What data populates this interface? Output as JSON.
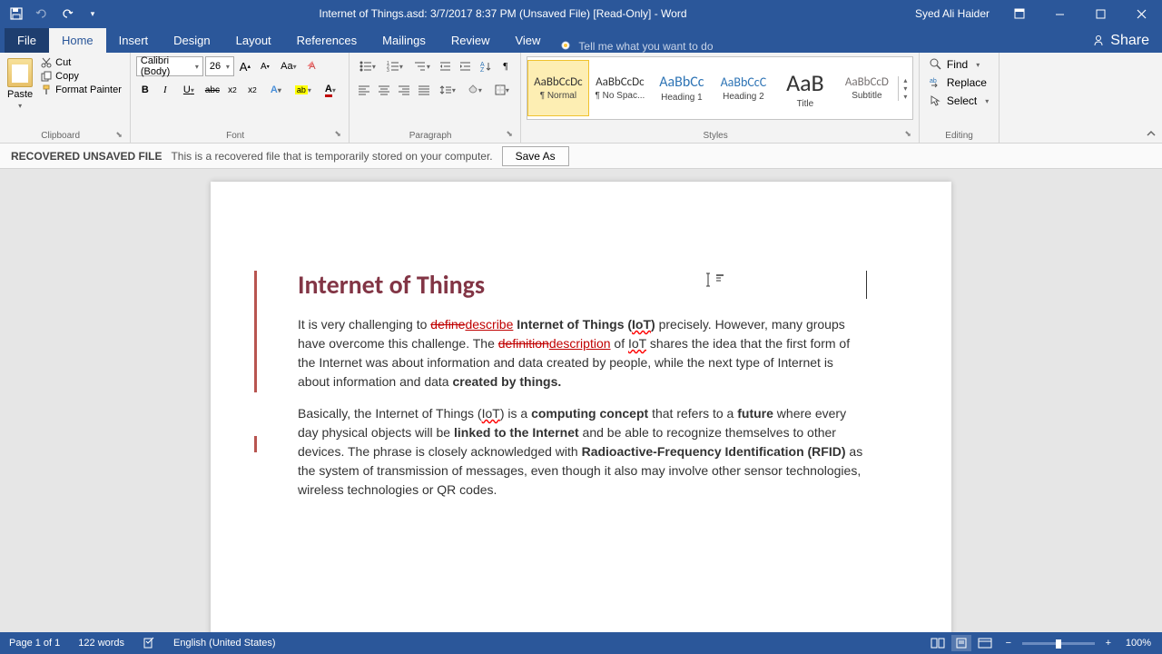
{
  "titlebar": {
    "title": "Internet of Things.asd: 3/7/2017 8:37 PM (Unsaved File) [Read-Only] - Word",
    "user": "Syed Ali Haider"
  },
  "tabs": {
    "file": "File",
    "home": "Home",
    "insert": "Insert",
    "design": "Design",
    "layout": "Layout",
    "references": "References",
    "mailings": "Mailings",
    "review": "Review",
    "view": "View",
    "tellme": "Tell me what you want to do",
    "share": "Share"
  },
  "clipboard": {
    "paste": "Paste",
    "cut": "Cut",
    "copy": "Copy",
    "formatpainter": "Format Painter",
    "label": "Clipboard"
  },
  "font": {
    "name": "Calibri (Body)",
    "size": "26",
    "label": "Font"
  },
  "paragraph": {
    "label": "Paragraph"
  },
  "styles": {
    "label": "Styles",
    "items": [
      {
        "preview": "AaBbCcDc",
        "name": "¶ Normal",
        "size": "13px",
        "color": "#333"
      },
      {
        "preview": "AaBbCcDc",
        "name": "¶ No Spac...",
        "size": "13px",
        "color": "#333"
      },
      {
        "preview": "AaBbCc",
        "name": "Heading 1",
        "size": "16px",
        "color": "#2e74b5"
      },
      {
        "preview": "AaBbCcC",
        "name": "Heading 2",
        "size": "14px",
        "color": "#2e74b5"
      },
      {
        "preview": "AaB",
        "name": "Title",
        "size": "26px",
        "color": "#333"
      },
      {
        "preview": "AaBbCcD",
        "name": "Subtitle",
        "size": "13px",
        "color": "#767171"
      }
    ]
  },
  "editing": {
    "find": "Find",
    "replace": "Replace",
    "select": "Select",
    "label": "Editing"
  },
  "recover": {
    "label": "RECOVERED UNSAVED FILE",
    "text": "This is a recovered file that is temporarily stored on your computer.",
    "button": "Save As"
  },
  "document": {
    "title": "Internet of Things",
    "p1_a": "It is very challenging to ",
    "p1_strike1": "define",
    "p1_ins1": "describe",
    "p1_b": " ",
    "p1_bold1": "Internet of Things (",
    "p1_iot1": "IoT",
    "p1_bold1b": ")",
    "p1_c": " precisely. However, many groups have overcome this challenge. The ",
    "p1_strike2": "definition",
    "p1_ins2": "description",
    "p1_d": " of ",
    "p1_iot2": "IoT",
    "p1_e": " shares the idea that the first form of the Internet was about information and data created by people, while the next type of Internet is about information and data ",
    "p1_bold2": "created by things.",
    "p2_a": "Basically, the Internet of Things (",
    "p2_iot": "IoT",
    "p2_b": ") is a ",
    "p2_bold1": "computing concept",
    "p2_c": " that refers to a ",
    "p2_bold2": "future",
    "p2_d": " where every day physical objects will be ",
    "p2_bold3": "linked to the Internet",
    "p2_e": " and be able to recognize themselves to other devices. The phrase is closely acknowledged with ",
    "p2_bold4": "Radioactive-Frequency Identification (RFID)",
    "p2_f": " as the system of transmission of messages, even though it also may involve other sensor technologies, wireless technologies or QR codes."
  },
  "status": {
    "page": "Page 1 of 1",
    "words": "122 words",
    "lang": "English (United States)",
    "zoom": "100%"
  }
}
